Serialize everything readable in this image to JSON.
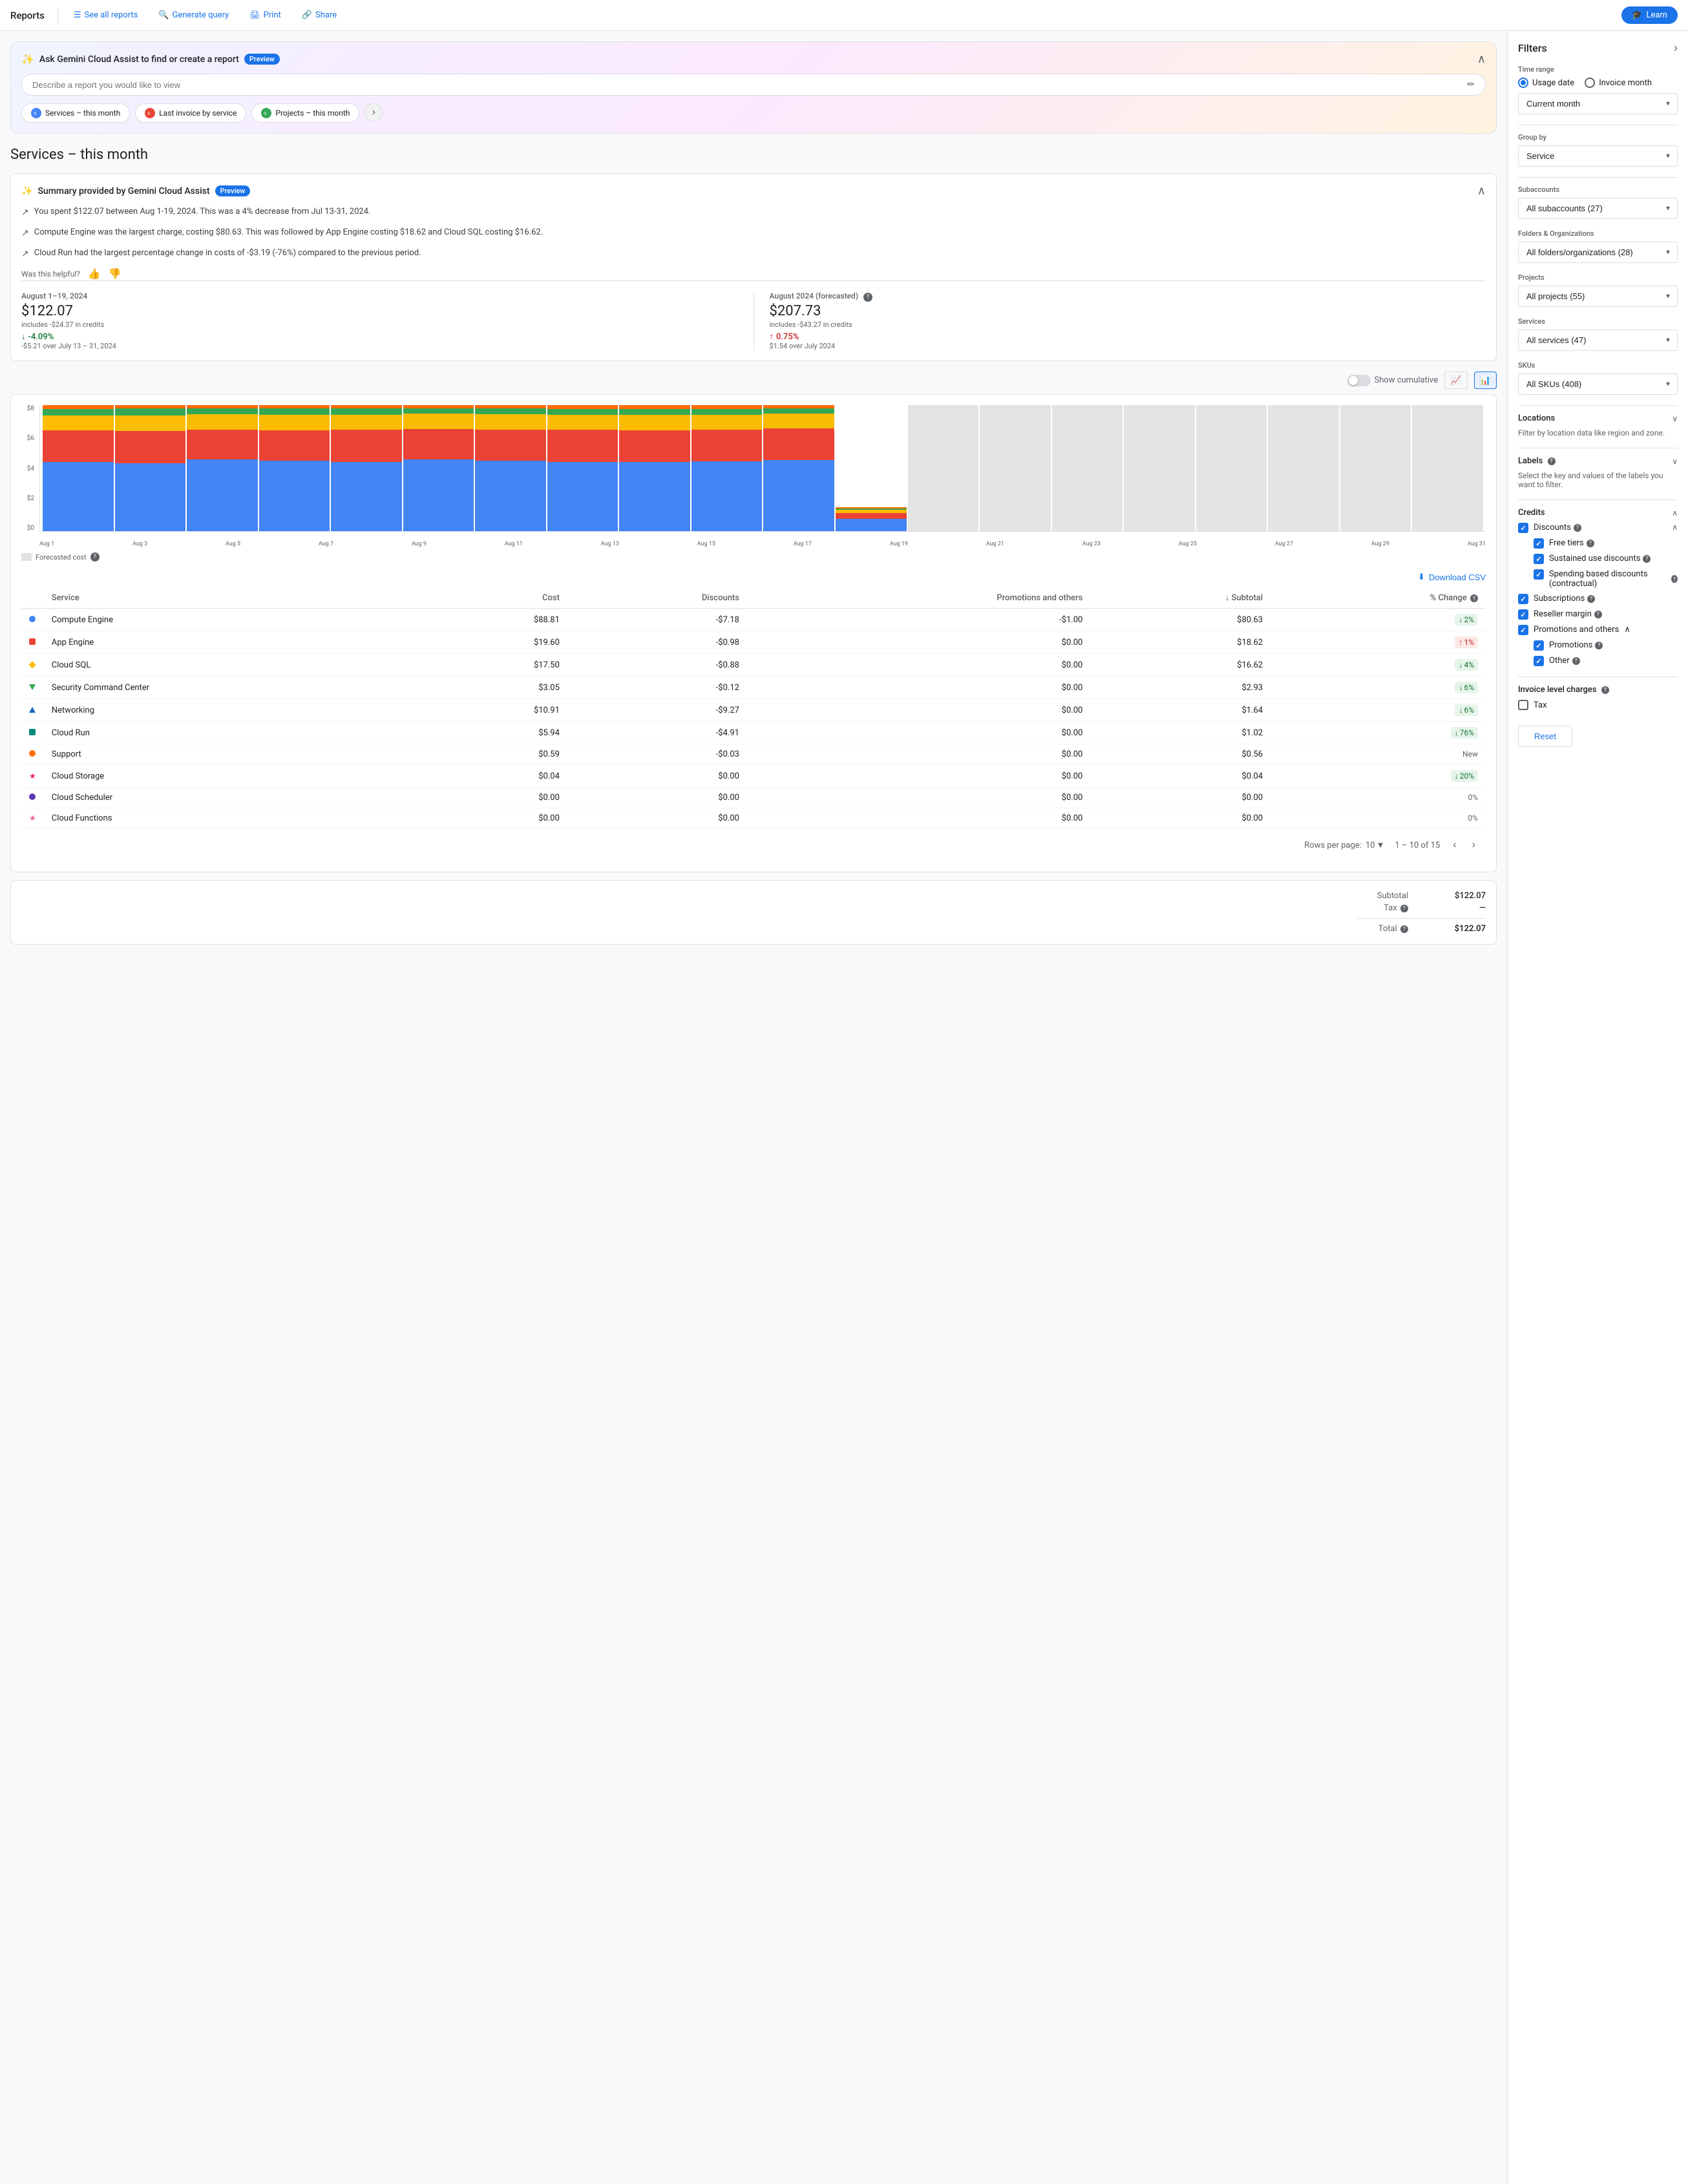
{
  "nav": {
    "brand": "Reports",
    "see_all": "See all reports",
    "generate": "Generate query",
    "print": "Print",
    "share": "Share",
    "learn": "Learn"
  },
  "gemini": {
    "title": "Ask Gemini Cloud Assist to find or create a report",
    "preview": "Preview",
    "input_placeholder": "Describe a report you would like to view",
    "chips": [
      "Services – this month",
      "Last invoice by service",
      "Projects – this month"
    ]
  },
  "page_title": "Services – this month",
  "summary": {
    "title": "Summary provided by Gemini Cloud Assist",
    "preview": "Preview",
    "bullets": [
      "You spent $122.07 between Aug 1-19, 2024. This was a 4% decrease from Jul 13-31, 2024.",
      "Compute Engine was the largest charge, costing $80.63. This was followed by App Engine costing $18.62 and Cloud SQL costing $16.62.",
      "Cloud Run had the largest percentage change in costs of -$3.19 (-76%) compared to the previous period."
    ],
    "helpful": "Was this helpful?"
  },
  "metrics": {
    "current": {
      "period": "August 1–19, 2024",
      "value": "$122.07",
      "sub": "includes -$24.37 in credits",
      "change": "-4.09%",
      "change_sub": "-$5.21 over July 13 – 31, 2024",
      "is_down": true
    },
    "forecasted": {
      "period": "August 2024 (forecasted)",
      "value": "$207.73",
      "sub": "includes -$43.27 in credits",
      "change": "0.75%",
      "change_sub": "$1.54 over July 2024",
      "is_up": true
    }
  },
  "chart": {
    "show_cumulative": "Show cumulative",
    "y_labels": [
      "$8",
      "$6",
      "$4",
      "$2",
      "$0"
    ],
    "x_labels": [
      "Aug 1",
      "Aug 3",
      "Aug 5",
      "Aug 7",
      "Aug 9",
      "Aug 11",
      "Aug 13",
      "Aug 15",
      "Aug 17",
      "Aug 19",
      "Aug 21",
      "Aug 23",
      "Aug 25",
      "Aug 27",
      "Aug 29",
      "Aug 31"
    ],
    "forecasted_legend": "Forecasted cost",
    "bars": [
      {
        "actual": true,
        "heights": [
          55,
          25,
          12,
          5,
          3
        ]
      },
      {
        "actual": true,
        "heights": [
          60,
          28,
          14,
          6,
          3
        ]
      },
      {
        "actual": true,
        "heights": [
          62,
          26,
          13,
          5,
          3
        ]
      },
      {
        "actual": true,
        "heights": [
          64,
          28,
          14,
          6,
          3
        ]
      },
      {
        "actual": true,
        "heights": [
          65,
          30,
          14,
          6,
          3
        ]
      },
      {
        "actual": true,
        "heights": [
          66,
          28,
          14,
          5,
          3
        ]
      },
      {
        "actual": true,
        "heights": [
          68,
          30,
          15,
          6,
          3
        ]
      },
      {
        "actual": true,
        "heights": [
          70,
          32,
          15,
          6,
          4
        ]
      },
      {
        "actual": true,
        "heights": [
          72,
          33,
          16,
          6,
          4
        ]
      },
      {
        "actual": true,
        "heights": [
          74,
          34,
          16,
          6,
          4
        ]
      },
      {
        "actual": true,
        "heights": [
          68,
          30,
          14,
          5,
          3
        ]
      },
      {
        "actual": true,
        "heights": [
          8,
          4,
          2,
          1,
          1
        ]
      },
      {
        "actual": false,
        "heights": [
          55,
          22,
          11,
          5,
          2
        ]
      },
      {
        "actual": false,
        "heights": [
          57,
          24,
          12,
          5,
          2
        ]
      },
      {
        "actual": false,
        "heights": [
          58,
          24,
          12,
          5,
          2
        ]
      },
      {
        "actual": false,
        "heights": [
          56,
          23,
          11,
          5,
          2
        ]
      },
      {
        "actual": false,
        "heights": [
          57,
          24,
          12,
          5,
          2
        ]
      },
      {
        "actual": false,
        "heights": [
          58,
          24,
          12,
          5,
          2
        ]
      },
      {
        "actual": false,
        "heights": [
          57,
          23,
          11,
          5,
          2
        ]
      },
      {
        "actual": false,
        "heights": [
          57,
          23,
          11,
          5,
          2
        ]
      }
    ],
    "bar_colors": [
      "#4285f4",
      "#ea4335",
      "#fbbc04",
      "#34a853",
      "#ff6d00"
    ]
  },
  "table": {
    "download_label": "Download CSV",
    "headers": [
      "Service",
      "Cost",
      "Discounts",
      "Promotions and others",
      "Subtotal",
      "% Change"
    ],
    "rows": [
      {
        "icon": "dot",
        "color": "#4285f4",
        "name": "Compute Engine",
        "cost": "$88.81",
        "discounts": "-$7.18",
        "promotions": "-$1.00",
        "subtotal": "$80.63",
        "change": "2%",
        "change_dir": "down"
      },
      {
        "icon": "square",
        "color": "#ea4335",
        "name": "App Engine",
        "cost": "$19.60",
        "discounts": "-$0.98",
        "promotions": "$0.00",
        "subtotal": "$18.62",
        "change": "1%",
        "change_dir": "up"
      },
      {
        "icon": "diamond",
        "color": "#fbbc04",
        "name": "Cloud SQL",
        "cost": "$17.50",
        "discounts": "-$0.88",
        "promotions": "$0.00",
        "subtotal": "$16.62",
        "change": "4%",
        "change_dir": "down"
      },
      {
        "icon": "triangle-down",
        "color": "#34a853",
        "name": "Security Command Center",
        "cost": "$3.05",
        "discounts": "-$0.12",
        "promotions": "$0.00",
        "subtotal": "$2.93",
        "change": "6%",
        "change_dir": "down"
      },
      {
        "icon": "triangle-up",
        "color": "#1565c0",
        "name": "Networking",
        "cost": "$10.91",
        "discounts": "-$9.27",
        "promotions": "$0.00",
        "subtotal": "$1.64",
        "change": "6%",
        "change_dir": "down"
      },
      {
        "icon": "square",
        "color": "#00897b",
        "name": "Cloud Run",
        "cost": "$5.94",
        "discounts": "-$4.91",
        "promotions": "$0.00",
        "subtotal": "$1.02",
        "change": "76%",
        "change_dir": "down"
      },
      {
        "icon": "dot",
        "color": "#ff6d00",
        "name": "Support",
        "cost": "$0.59",
        "discounts": "-$0.03",
        "promotions": "$0.00",
        "subtotal": "$0.56",
        "change": "New",
        "change_dir": "new"
      },
      {
        "icon": "star",
        "color": "#e91e63",
        "name": "Cloud Storage",
        "cost": "$0.04",
        "discounts": "$0.00",
        "promotions": "$0.00",
        "subtotal": "$0.04",
        "change": "20%",
        "change_dir": "down"
      },
      {
        "icon": "dot",
        "color": "#5e35b1",
        "name": "Cloud Scheduler",
        "cost": "$0.00",
        "discounts": "$0.00",
        "promotions": "$0.00",
        "subtotal": "$0.00",
        "change": "0%",
        "change_dir": "neutral"
      },
      {
        "icon": "star",
        "color": "#f06292",
        "name": "Cloud Functions",
        "cost": "$0.00",
        "discounts": "$0.00",
        "promotions": "$0.00",
        "subtotal": "$0.00",
        "change": "0%",
        "change_dir": "neutral"
      }
    ],
    "pagination": {
      "rows_per_page": "Rows per page:",
      "rows_count": "10",
      "range": "1 – 10 of 15"
    },
    "totals": {
      "subtotal_label": "Subtotal",
      "subtotal_value": "$122.07",
      "tax_label": "Tax",
      "tax_value": "—",
      "total_label": "Total",
      "total_value": "$122.07"
    }
  },
  "filters": {
    "title": "Filters",
    "time_range": {
      "label": "Time range",
      "usage_date": "Usage date",
      "invoice_month": "Invoice month"
    },
    "current_month": "Current month",
    "group_by": {
      "label": "Group by",
      "value": "Service"
    },
    "subaccounts": {
      "label": "Subaccounts",
      "value": "All subaccounts (27)"
    },
    "folders": {
      "label": "Folders & Organizations",
      "value": "All folders/organizations (28)"
    },
    "projects": {
      "label": "Projects",
      "value": "All projects (55)"
    },
    "services": {
      "label": "Services",
      "value": "All services (47)"
    },
    "skus": {
      "label": "SKUs",
      "value": "All SKUs (408)"
    },
    "locations": {
      "label": "Locations",
      "desc": "Filter by location data like region and zone."
    },
    "labels": {
      "label": "Labels",
      "desc": "Select the key and values of the labels you want to filter."
    },
    "credits": {
      "label": "Credits",
      "discounts": "Discounts",
      "free_tiers": "Free tiers",
      "sustained_use": "Sustained use discounts",
      "spending_based": "Spending based discounts (contractual)",
      "subscriptions": "Subscriptions",
      "reseller_margin": "Reseller margin",
      "promotions_others": "Promotions and others",
      "promotions": "Promotions",
      "other": "Other"
    },
    "invoice_charges": {
      "label": "Invoice level charges",
      "tax": "Tax"
    },
    "reset_label": "Reset"
  }
}
